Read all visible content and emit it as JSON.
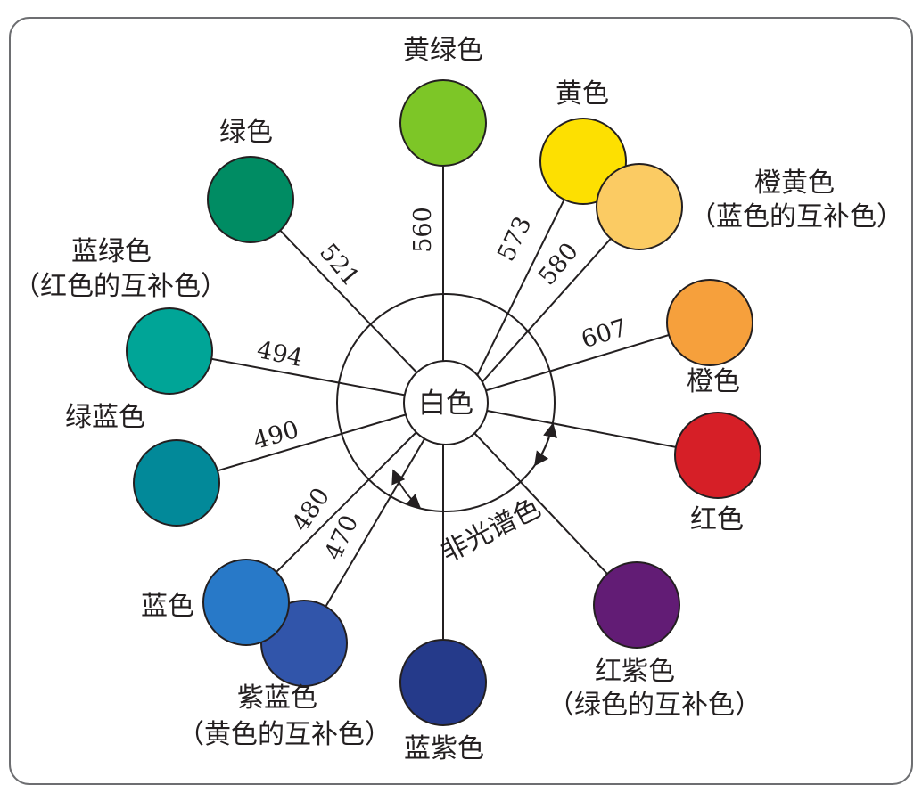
{
  "center": {
    "label": "白色"
  },
  "non_spectral": {
    "label": "非光谱色"
  },
  "colors": [
    {
      "id": "yellow-green",
      "label": [
        "黄绿色"
      ],
      "wavelength": "560",
      "fill": "#7dc627"
    },
    {
      "id": "yellow",
      "label": [
        "黄色"
      ],
      "wavelength": "573",
      "fill": "#fde001"
    },
    {
      "id": "orange-yellow",
      "label": [
        "橙黄色",
        "（蓝色的互补色）"
      ],
      "wavelength": "580",
      "fill": "#fbcb63"
    },
    {
      "id": "orange",
      "label": [
        "橙色"
      ],
      "wavelength": "607",
      "fill": "#f6a03c"
    },
    {
      "id": "red",
      "label": [
        "红色"
      ],
      "wavelength": "",
      "fill": "#d61f27"
    },
    {
      "id": "red-purple",
      "label": [
        "红紫色",
        "（绿色的互补色）"
      ],
      "wavelength": "",
      "fill": "#621c75"
    },
    {
      "id": "blue-violet",
      "label": [
        "蓝紫色"
      ],
      "wavelength": "",
      "fill": "#253a8a"
    },
    {
      "id": "violet-blue",
      "label": [
        "紫蓝色",
        "（黄色的互补色）"
      ],
      "wavelength": "470",
      "fill": "#3155aa"
    },
    {
      "id": "blue",
      "label": [
        "蓝色"
      ],
      "wavelength": "480",
      "fill": "#2879c8"
    },
    {
      "id": "green-blue",
      "label": [
        "绿蓝色"
      ],
      "wavelength": "490",
      "fill": "#028999"
    },
    {
      "id": "blue-green",
      "label": [
        "蓝绿色",
        "（红色的互补色）"
      ],
      "wavelength": "494",
      "fill": "#00a597"
    },
    {
      "id": "green",
      "label": [
        "绿色"
      ],
      "wavelength": "521",
      "fill": "#008c63"
    }
  ]
}
